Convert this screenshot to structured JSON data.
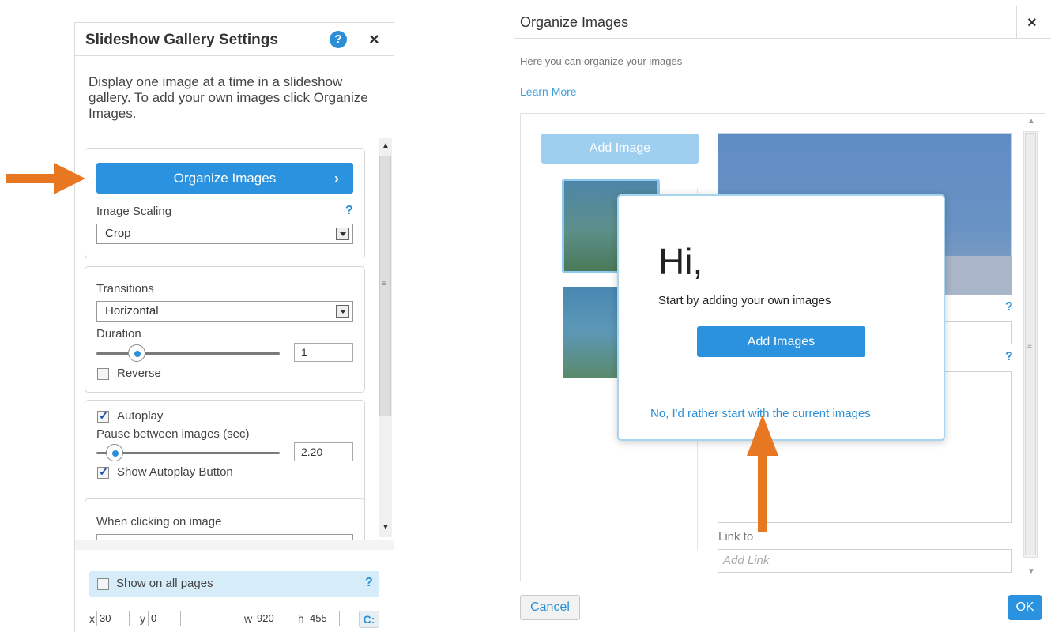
{
  "settings_panel": {
    "title": "Slideshow Gallery Settings",
    "help_icon": "?",
    "close_icon": "×",
    "description": "Display one image at a time in a slideshow gallery. To add your own images click Organize Images.",
    "organize_button": "Organize Images",
    "organize_chevron": "›",
    "image_scaling": {
      "label": "Image Scaling",
      "help": "?",
      "value": "Crop"
    },
    "transitions": {
      "label": "Transitions",
      "value": "Horizontal"
    },
    "duration": {
      "label": "Duration",
      "value": "1",
      "slider_fraction": 0.22
    },
    "reverse": {
      "label": "Reverse",
      "checked": false
    },
    "autoplay": {
      "label": "Autoplay",
      "checked": true
    },
    "pause": {
      "label": "Pause between images (sec)",
      "value": "2.20",
      "slider_fraction": 0.1
    },
    "show_autoplay_button": {
      "label": "Show Autoplay Button",
      "checked": true
    },
    "when_clicking": {
      "label": "When clicking on image"
    },
    "show_on_all_pages": {
      "label": "Show on all pages",
      "help": "?",
      "checked": false
    },
    "position": {
      "x_label": "x",
      "x": "30",
      "y_label": "y",
      "y": "0",
      "w_label": "w",
      "w": "920",
      "h_label": "h",
      "h": "455"
    },
    "lock_icon": "C:",
    "scroll_up": "▲",
    "scroll_down": "▼",
    "scroll_grip": "≡"
  },
  "organize_panel": {
    "title": "Organize Images",
    "close_icon": "×",
    "subtitle": "Here you can organize your images",
    "learn_more": "Learn More",
    "add_image_button": "Add Image",
    "help_1": "?",
    "help_2": "?",
    "link_label": "Link to",
    "link_placeholder": "Add Link",
    "cancel_button": "Cancel",
    "ok_button": "OK",
    "scroll_up": "▲",
    "scroll_down": "▼",
    "scroll_grip": "≡"
  },
  "welcome_modal": {
    "greeting": "Hi,",
    "message": "Start by adding your own images",
    "add_button": "Add Images",
    "decline_link": "No, I'd rather start with the current images"
  },
  "colors": {
    "accent": "#2a92de",
    "annotation_arrow": "#e87722",
    "highlight_bg": "#d6ecf8"
  }
}
